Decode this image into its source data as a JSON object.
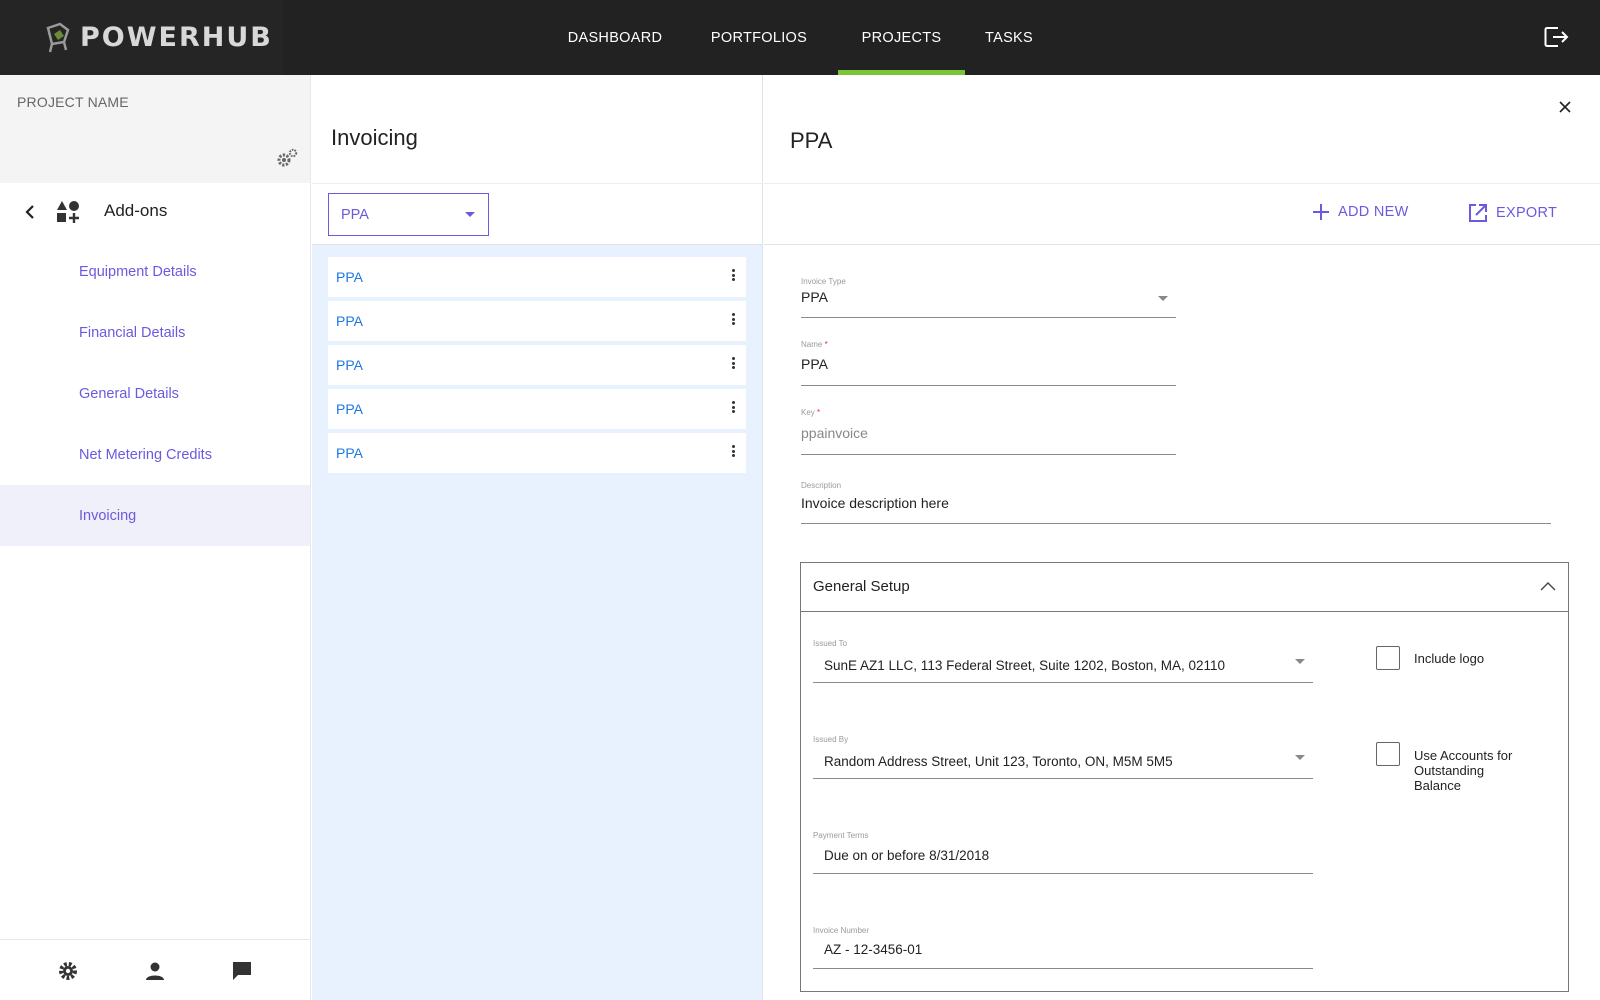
{
  "app": {
    "logo_text": "POWERHUB"
  },
  "nav": {
    "items": [
      "DASHBOARD",
      "PORTFOLIOS",
      "PROJECTS",
      "TASKS"
    ],
    "active": "PROJECTS"
  },
  "sidebar": {
    "project_name": "PROJECT NAME",
    "section": "Add-ons",
    "items": [
      {
        "label": "Equipment Details"
      },
      {
        "label": "Financial Details"
      },
      {
        "label": "General Details"
      },
      {
        "label": "Net Metering Credits"
      },
      {
        "label": "Invoicing"
      }
    ],
    "active_item": "Invoicing"
  },
  "middle": {
    "title": "Invoicing",
    "filter_value": "PPA",
    "list": [
      "PPA",
      "PPA",
      "PPA",
      "PPA",
      "PPA"
    ]
  },
  "detail": {
    "title": "PPA",
    "toolbar": {
      "add_new": "ADD NEW",
      "export": "EXPORT"
    },
    "fields": {
      "invoice_type": {
        "label": "Invoice Type",
        "value": "PPA"
      },
      "name": {
        "label": "Name",
        "required": "*",
        "value": "PPA"
      },
      "key": {
        "label": "Key",
        "required": "*",
        "value": "ppainvoice"
      },
      "description": {
        "label": "Description",
        "value": "Invoice description here"
      }
    },
    "general_setup": {
      "title": "General Setup",
      "issued_to": {
        "label": "Issued To",
        "value": "SunE AZ1 LLC, 113 Federal Street, Suite 1202, Boston, MA, 02110"
      },
      "issued_by": {
        "label": "Issued By",
        "value": "Random Address Street, Unit 123, Toronto, ON, M5M 5M5"
      },
      "payment_terms": {
        "label": "Payment Terms",
        "value": "Due on or before 8/31/2018"
      },
      "invoice_number": {
        "label": "Invoice Number",
        "value": "AZ - 12-3456-01"
      },
      "include_logo": {
        "label": "Include logo",
        "checked": false
      },
      "use_accounts": {
        "label": "Use Accounts for Outstanding Balance",
        "checked": false
      }
    }
  },
  "colors": {
    "accent": "#6a5ae0",
    "link": "#1e78e0",
    "nav_active": "#7ac43a",
    "topbar": "#222222"
  }
}
